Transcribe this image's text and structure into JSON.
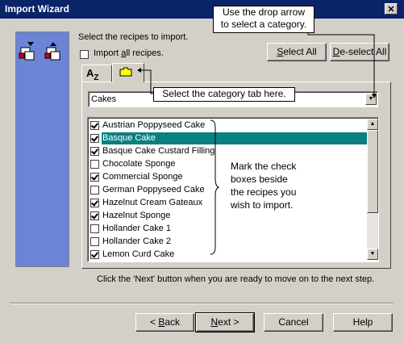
{
  "window": {
    "title": "Import Wizard",
    "close_glyph": "✕"
  },
  "instructions": "Select the recipes to import.",
  "import_all": {
    "label_pre": "Import ",
    "label_accel": "a",
    "label_post": "ll recipes.",
    "checked": false
  },
  "buttons": {
    "select_all_accel": "S",
    "select_all_rest": "elect All",
    "deselect_all_accel": "D",
    "deselect_all_rest": "e-select All",
    "back_pre": "< ",
    "back_accel": "B",
    "back_rest": "ack",
    "next_accel": "N",
    "next_rest": "ext >",
    "cancel": "Cancel",
    "help": "Help"
  },
  "tabs": {
    "alpha_label": "A",
    "alpha_sub": "Z",
    "category_icon": "folder-icon"
  },
  "category": {
    "selected": "Cakes"
  },
  "recipes": [
    {
      "name": "Austrian Poppyseed Cake",
      "checked": true,
      "selected": false
    },
    {
      "name": "Basque Cake",
      "checked": true,
      "selected": true
    },
    {
      "name": "Basque Cake Custard Filling",
      "checked": true,
      "selected": false
    },
    {
      "name": "Chocolate Sponge",
      "checked": false,
      "selected": false
    },
    {
      "name": "Commercial Sponge",
      "checked": true,
      "selected": false
    },
    {
      "name": "German Poppyseed Cake",
      "checked": false,
      "selected": false
    },
    {
      "name": "Hazelnut Cream Gateaux",
      "checked": true,
      "selected": false
    },
    {
      "name": "Hazelnut Sponge",
      "checked": true,
      "selected": false
    },
    {
      "name": "Hollander Cake 1",
      "checked": false,
      "selected": false
    },
    {
      "name": "Hollander Cake 2",
      "checked": false,
      "selected": false
    },
    {
      "name": "Lemon Curd Cake",
      "checked": true,
      "selected": false
    }
  ],
  "callouts": {
    "dropdown_line1": "Use the drop arrow",
    "dropdown_line2": "to select a category.",
    "tab": "Select the category tab here.",
    "check_line1": "Mark the check",
    "check_line2": "boxes beside",
    "check_line3": "the recipes you",
    "check_line4": "wish to import."
  },
  "footer_hint": "Click the 'Next' button when you are ready to move on to the next step.",
  "colors": {
    "titlebar": "#0a246a",
    "side_panel": "#6b84d6",
    "selection": "#0b8080",
    "face": "#d4d0c8"
  }
}
